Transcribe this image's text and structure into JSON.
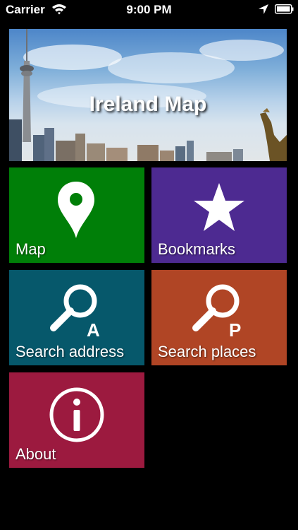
{
  "status_bar": {
    "carrier": "Carrier",
    "time": "9:00 PM"
  },
  "banner": {
    "title": "Ireland Map"
  },
  "tiles": [
    {
      "label": "Map",
      "icon": "map-pin-icon",
      "color": "#007f08"
    },
    {
      "label": "Bookmarks",
      "icon": "star-icon",
      "color": "#4d2a91"
    },
    {
      "label": "Search address",
      "icon": "search-address-icon",
      "color": "#06586b",
      "badge": "A"
    },
    {
      "label": "Search places",
      "icon": "search-places-icon",
      "color": "#b04525",
      "badge": "P"
    },
    {
      "label": "About",
      "icon": "info-icon",
      "color": "#9c1a3f"
    }
  ]
}
